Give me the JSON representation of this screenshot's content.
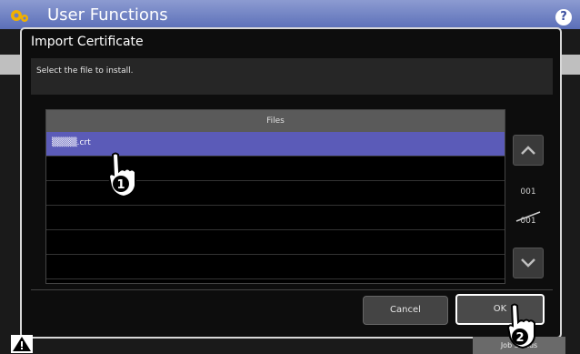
{
  "app": {
    "title": "User Functions",
    "help_label": "?"
  },
  "dialog": {
    "title": "Import Certificate",
    "message": "Select the file to install.",
    "list_header": "Files",
    "files": [
      {
        "name": "▒▒▒▒.crt",
        "selected": true
      },
      {
        "name": "",
        "selected": false
      },
      {
        "name": "",
        "selected": false
      },
      {
        "name": "",
        "selected": false
      },
      {
        "name": "",
        "selected": false
      },
      {
        "name": "",
        "selected": false
      }
    ],
    "page_current": "001",
    "page_total": "001",
    "cancel_label": "Cancel",
    "ok_label": "OK"
  },
  "footer": {
    "job_status_label": "Job Status"
  },
  "callouts": {
    "step1": "1",
    "step2": "2"
  },
  "colors": {
    "accent": "#5b5bb8",
    "titlebar": "#6b7cc4"
  }
}
